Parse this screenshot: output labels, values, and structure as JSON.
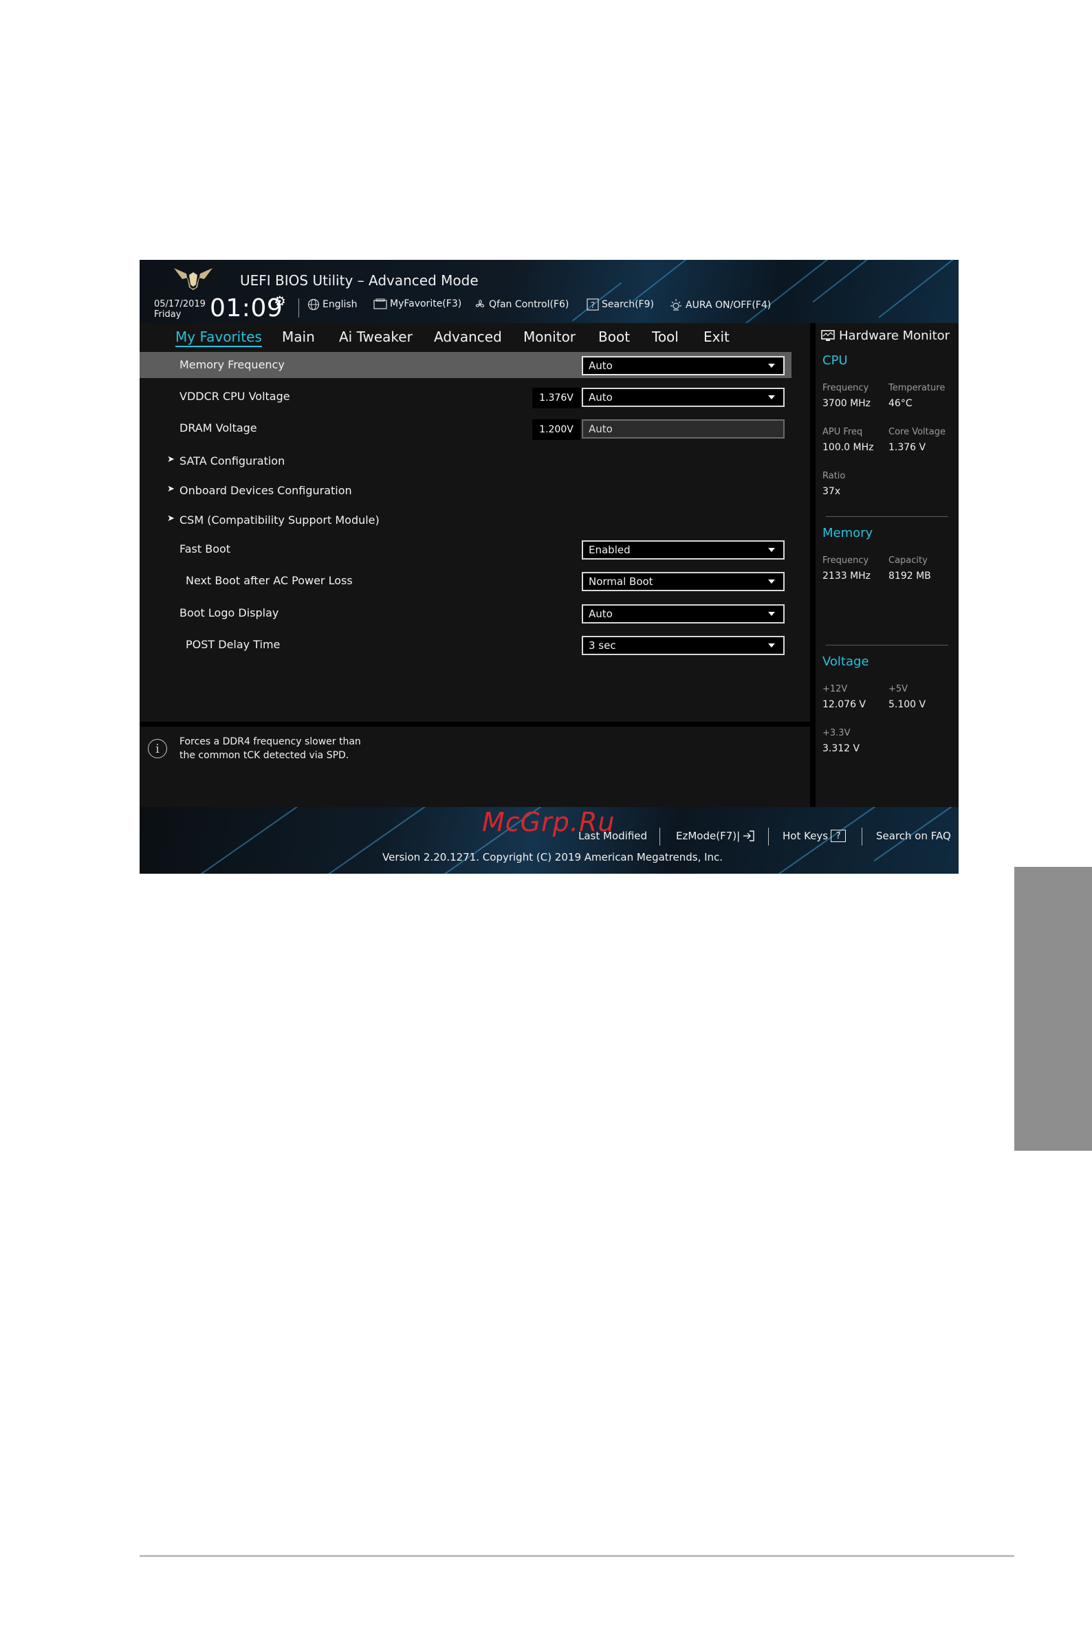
{
  "header": {
    "title": "UEFI BIOS Utility – Advanced Mode",
    "date": "05/17/2019",
    "day": "Friday",
    "time": "01:09",
    "language": "English",
    "myfavorite": "MyFavorite(F3)",
    "qfan": "Qfan Control(F6)",
    "search": "Search(F9)",
    "aura": "AURA ON/OFF(F4)"
  },
  "tabs": [
    "My Favorites",
    "Main",
    "Ai Tweaker",
    "Advanced",
    "Monitor",
    "Boot",
    "Tool",
    "Exit"
  ],
  "active_tab": "My Favorites",
  "settings": [
    {
      "label": "Memory Frequency",
      "value": "Auto"
    },
    {
      "label": "VDDCR CPU Voltage",
      "reading": "1.376V",
      "value": "Auto"
    },
    {
      "label": "DRAM Voltage",
      "reading": "1.200V",
      "value": "Auto"
    },
    {
      "label": "SATA Configuration"
    },
    {
      "label": "Onboard Devices Configuration"
    },
    {
      "label": "CSM (Compatibility Support Module)"
    },
    {
      "label": "Fast Boot",
      "value": "Enabled"
    },
    {
      "label": "Next Boot after AC Power Loss",
      "value": "Normal Boot"
    },
    {
      "label": "Boot Logo Display",
      "value": "Auto"
    },
    {
      "label": "POST Delay Time",
      "value": "3 sec"
    }
  ],
  "help": {
    "line1": "Forces a DDR4 frequency slower than",
    "line2": "the common tCK detected via SPD."
  },
  "hardware_monitor": {
    "title": "Hardware Monitor",
    "cpu": {
      "heading": "CPU",
      "frequency_label": "Frequency",
      "frequency": "3700 MHz",
      "temperature_label": "Temperature",
      "temperature": "46°C",
      "apu_freq_label": "APU Freq",
      "apu_freq": "100.0 MHz",
      "core_voltage_label": "Core Voltage",
      "core_voltage": "1.376 V",
      "ratio_label": "Ratio",
      "ratio": "37x"
    },
    "memory": {
      "heading": "Memory",
      "frequency_label": "Frequency",
      "frequency": "2133 MHz",
      "capacity_label": "Capacity",
      "capacity": "8192 MB"
    },
    "voltage": {
      "heading": "Voltage",
      "v12_label": "+12V",
      "v12": "12.076 V",
      "v5_label": "+5V",
      "v5": "5.100 V",
      "v33_label": "+3.3V",
      "v33": "3.312 V"
    }
  },
  "footer": {
    "last_modified": "Last Modified",
    "ezmode": "EzMode(F7)|",
    "hotkeys": "Hot Keys",
    "hotkeys_key": "?",
    "search_faq": "Search on FAQ",
    "version": "Version 2.20.1271. Copyright (C) 2019 American Megatrends, Inc.",
    "watermark": "McGrp.Ru"
  },
  "colors": {
    "accent": "#29c1dc",
    "background": "#141414",
    "highlight_row": "#5d5d5d",
    "watermark": "#d9262c"
  },
  "icons": [
    "logo-icon",
    "gear-icon",
    "globe-icon",
    "myfavorite-icon",
    "fan-icon",
    "search-icon",
    "aura-icon",
    "monitor-icon",
    "info-icon",
    "exit-icon"
  ]
}
